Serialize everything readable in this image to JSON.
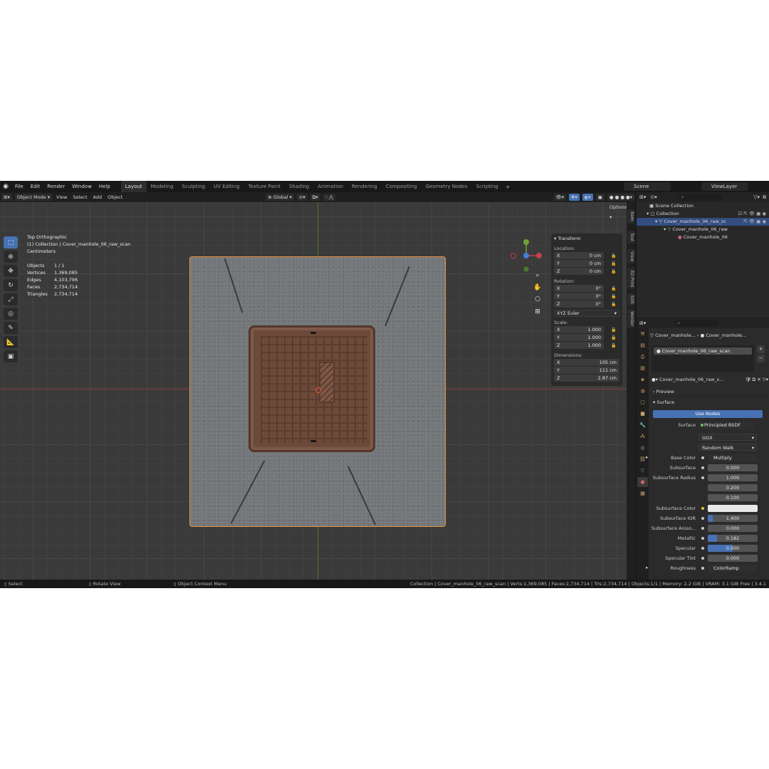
{
  "menu": [
    "File",
    "Edit",
    "Render",
    "Window",
    "Help"
  ],
  "workspaces": [
    "Layout",
    "Modeling",
    "Sculpting",
    "UV Editing",
    "Texture Paint",
    "Shading",
    "Animation",
    "Rendering",
    "Compositing",
    "Geometry Nodes",
    "Scripting"
  ],
  "active_workspace": "Layout",
  "scene_name": "Scene",
  "view_layer": "ViewLayer",
  "viewport_header": {
    "mode": "Object Mode",
    "view": "View",
    "select": "Select",
    "add": "Add",
    "object": "Object",
    "orientation": "Global",
    "options": "Options"
  },
  "overlay": {
    "view_name": "Top Orthographic",
    "collection_line": "(1) Collection | Cover_manhole_06_raw_scan",
    "units": "Centimeters",
    "stats": [
      {
        "label": "Objects",
        "value": "1 / 1"
      },
      {
        "label": "Vertices",
        "value": "1,369,085"
      },
      {
        "label": "Edges",
        "value": "4,103,796"
      },
      {
        "label": "Faces",
        "value": "2,734,714"
      },
      {
        "label": "Triangles",
        "value": "2,734,714"
      }
    ]
  },
  "transform": {
    "title": "Transform",
    "location_label": "Location:",
    "location": {
      "x": "0 cm",
      "y": "0 cm",
      "z": "0 cm"
    },
    "rotation_label": "Rotation:",
    "rotation": {
      "x": "0°",
      "y": "0°",
      "z": "0°"
    },
    "rotation_mode": "XYZ Euler",
    "scale_label": "Scale:",
    "scale": {
      "x": "1.000",
      "y": "1.000",
      "z": "1.000"
    },
    "dimensions_label": "Dimensions:",
    "dimensions": {
      "x": "105 cm",
      "y": "111 cm",
      "z": "2.87 cm"
    }
  },
  "sidebar_tabs": [
    "Item",
    "Tool",
    "View",
    "3D-Print",
    "Edit",
    "Welder"
  ],
  "outliner": {
    "scene_collection": "Scene Collection",
    "collection": "Collection",
    "object": "Cover_manhole_06_raw_sc",
    "mesh": "Cover_manhole_06_raw",
    "material": "Cover_manhole_06"
  },
  "properties": {
    "breadcrumb_object": "Cover_manhole...",
    "breadcrumb_material": "Cover_manhole...",
    "slot_name": "Cover_manhole_06_raw_scan",
    "material_name": "Cover_manhole_06_raw_s...",
    "preview_label": "Preview",
    "surface_label": "Surface",
    "use_nodes": "Use Nodes",
    "surface_shader": "Principled BSDF",
    "distribution": "GGX",
    "subsurface_method": "Random Walk",
    "rows": [
      {
        "label": "Base Color",
        "value": "Multiply",
        "kind": "link"
      },
      {
        "label": "Subsurface",
        "value": "0.000",
        "kind": "num",
        "fill": 0
      },
      {
        "label": "Subsurface Radius",
        "value": "1.000",
        "kind": "num",
        "fill": 0
      },
      {
        "label": "",
        "value": "0.200",
        "kind": "num",
        "fill": 0
      },
      {
        "label": "",
        "value": "0.100",
        "kind": "num",
        "fill": 0
      },
      {
        "label": "Subsurface Color",
        "value": "",
        "kind": "color"
      },
      {
        "label": "Subsurface IOR",
        "value": "1.400",
        "kind": "num",
        "fill": 0.1
      },
      {
        "label": "Subsurface Aniso...",
        "value": "0.000",
        "kind": "num",
        "fill": 0
      },
      {
        "label": "Metallic",
        "value": "0.182",
        "kind": "num",
        "fill": 0.182
      },
      {
        "label": "Specular",
        "value": "0.500",
        "kind": "num",
        "fill": 0.5
      },
      {
        "label": "Specular Tint",
        "value": "0.000",
        "kind": "num",
        "fill": 0
      },
      {
        "label": "Roughness",
        "value": "ColorRamp",
        "kind": "link"
      }
    ]
  },
  "status": {
    "select": "Select",
    "rotate": "Rotate View",
    "context": "Object Context Menu",
    "info": "Collection | Cover_manhole_06_raw_scan | Verts:1,369,085 | Faces:2,734,714 | Tris:2,734,714 | Objects:1/1 | Memory: 2.2 GiB | VRAM: 3.1 GiB Free | 3.4.1"
  },
  "colors": {
    "accent": "#4772b3",
    "selection_outline": "#e8923c",
    "x_axis": "#c93d4b",
    "y_axis": "#6fa534",
    "z_axis": "#3f7ddb"
  }
}
